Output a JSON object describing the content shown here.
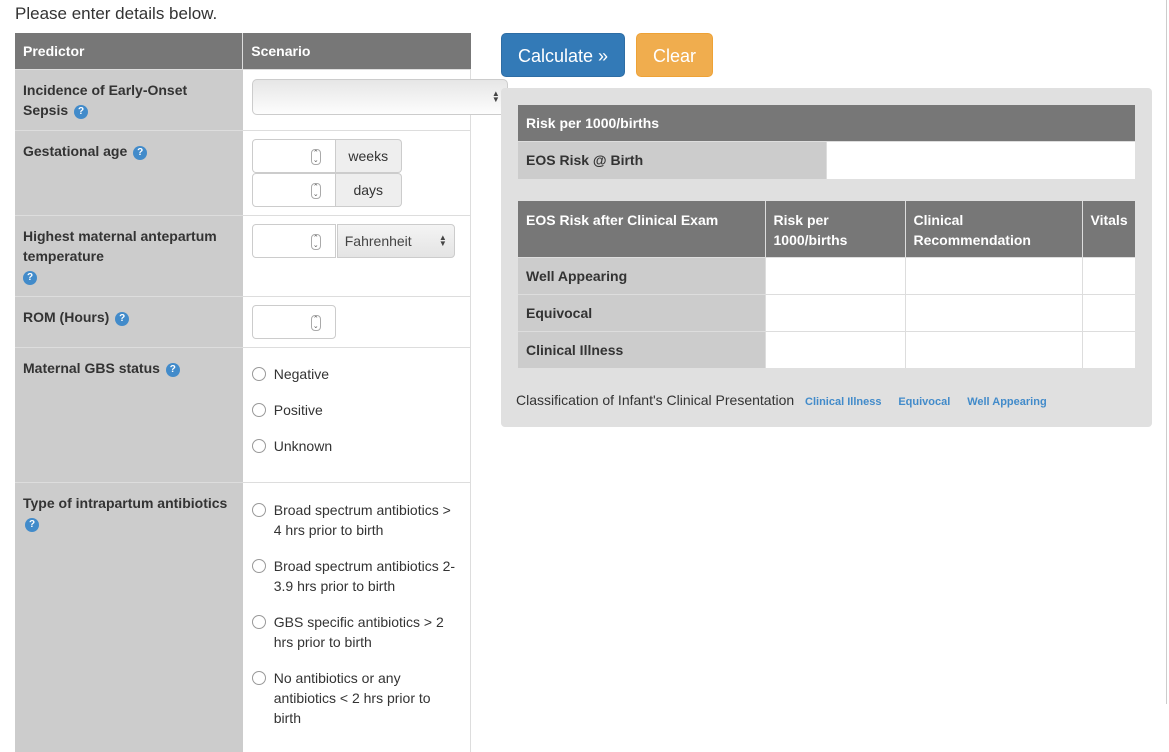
{
  "heading": "Please enter details below.",
  "form": {
    "headers": {
      "predictor": "Predictor",
      "scenario": "Scenario"
    },
    "incidence": {
      "label": "Incidence of Early-Onset Sepsis",
      "selected": ""
    },
    "gestational_age": {
      "label": "Gestational age",
      "weeks_value": "",
      "weeks_unit": "weeks",
      "days_value": "",
      "days_unit": "days"
    },
    "temperature": {
      "label": "Highest maternal antepartum temperature",
      "value": "",
      "unit_selected": "Fahrenheit"
    },
    "rom": {
      "label": "ROM (Hours)",
      "value": ""
    },
    "gbs": {
      "label": "Maternal GBS status",
      "options": [
        "Negative",
        "Positive",
        "Unknown"
      ]
    },
    "antibiotics": {
      "label": "Type of intrapartum antibiotics",
      "options": [
        "Broad spectrum antibiotics > 4 hrs prior to birth",
        "Broad spectrum antibiotics 2-3.9 hrs prior to birth",
        "GBS specific antibiotics > 2 hrs prior to birth",
        "No antibiotics or any antibiotics < 2 hrs prior to birth"
      ]
    },
    "help_glyph": "?"
  },
  "buttons": {
    "calculate": "Calculate »",
    "clear": "Clear"
  },
  "results": {
    "birth_table": {
      "header": "Risk per 1000/births",
      "row_label": "EOS Risk @ Birth",
      "row_value": ""
    },
    "exam_table": {
      "headers": [
        "EOS Risk after Clinical Exam",
        "Risk per 1000/births",
        "Clinical Recommendation",
        "Vitals"
      ],
      "rows": [
        {
          "label": "Well Appearing",
          "risk": "",
          "recommendation": "",
          "vitals": ""
        },
        {
          "label": "Equivocal",
          "risk": "",
          "recommendation": "",
          "vitals": ""
        },
        {
          "label": "Clinical Illness",
          "risk": "",
          "recommendation": "",
          "vitals": ""
        }
      ]
    },
    "classification": {
      "label": "Classification of Infant's Clinical Presentation",
      "links": [
        "Clinical Illness",
        "Equivocal",
        "Well Appearing"
      ]
    }
  },
  "colors": {
    "primary": "#337ab7",
    "warning": "#f0ad4e",
    "header_gray": "#777777",
    "label_gray": "#cccccc",
    "link_blue": "#428bca"
  }
}
